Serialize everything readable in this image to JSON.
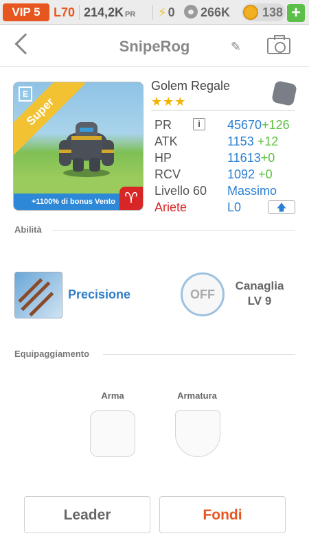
{
  "topbar": {
    "vip": "VIP 5",
    "level": "L70",
    "pr_value": "214,2K",
    "pr_unit": "PR",
    "energy": "0",
    "food": "266K",
    "coins": "138",
    "plus_icon": "+"
  },
  "header": {
    "title": "SnipeRog",
    "back_icon": "chevron-left-icon",
    "edit_icon": "pencil-icon",
    "camera_icon": "camera-icon"
  },
  "monster": {
    "ribbon": "Super",
    "element_badge": "E",
    "bonus": "+1100% di bonus Vento",
    "sign_icon": "♈",
    "name": "Golem Regale",
    "stars": "★★★",
    "stats": [
      {
        "label": "PR",
        "value": "45670",
        "bonus": "+126"
      },
      {
        "label": "ATK",
        "value": "1153",
        "bonus": "+12"
      },
      {
        "label": "HP",
        "value": "11613",
        "bonus": "+0"
      },
      {
        "label": "RCV",
        "value": "1092",
        "bonus": "+0"
      }
    ],
    "level_label": "Livello 60",
    "level_value": "Massimo",
    "sign_label": "Ariete",
    "sign_value": "L0",
    "info_icon": "i",
    "upgrade_icon": "🡅"
  },
  "abilities": {
    "section_title": "Abilità",
    "skill_name": "Precisione",
    "leader_state": "OFF",
    "leader_name": "Canaglia",
    "leader_level": "LV 9"
  },
  "equipment": {
    "section_title": "Equipaggiamento",
    "weapon_label": "Arma",
    "armor_label": "Armatura"
  },
  "actions": {
    "leader_label": "Leader",
    "merge_label": "Fondi",
    "leader_color": "#666666",
    "merge_color": "#e8561f"
  },
  "colors": {
    "accent_orange": "#e8561f",
    "stat_blue": "#2a7fd2",
    "bonus_green": "#5cc040",
    "aries_red": "#d82525"
  }
}
